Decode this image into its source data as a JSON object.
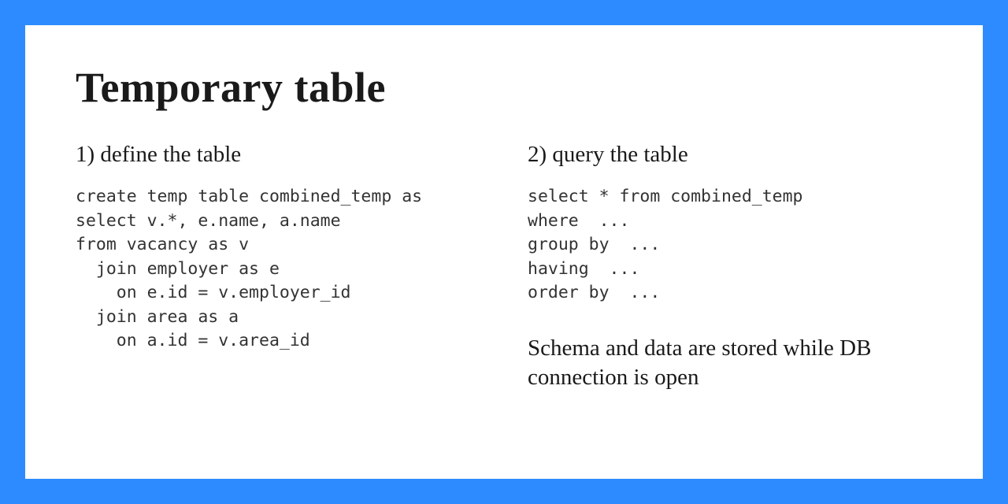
{
  "title": "Temporary table",
  "left": {
    "heading": "1) define the table",
    "code": "create temp table combined_temp as\nselect v.*, e.name, a.name\nfrom vacancy as v\n  join employer as e\n    on e.id = v.employer_id\n  join area as a\n    on a.id = v.area_id"
  },
  "right": {
    "heading": "2) query the table",
    "code": "select * from combined_temp\nwhere  ...\ngroup by  ...\nhaving  ...\norder by  ...",
    "note": "Schema and data are stored while DB connection is open"
  }
}
